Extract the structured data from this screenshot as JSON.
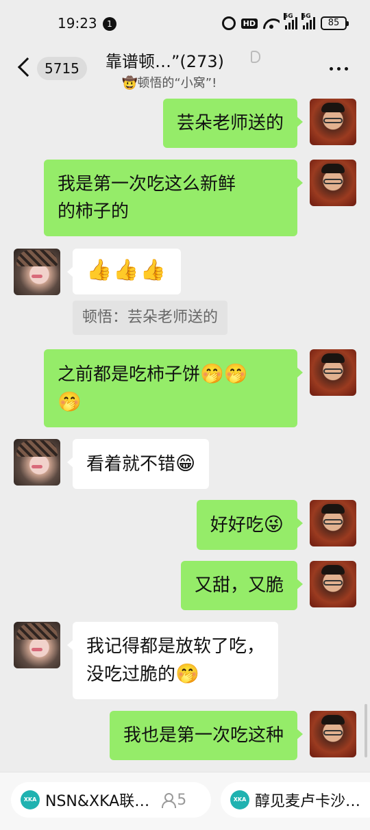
{
  "status_bar": {
    "time": "19:23",
    "notification_count": "1",
    "hd_label": "HD",
    "signal1_label": "5G",
    "signal2_label": "5G",
    "battery": "85"
  },
  "header": {
    "unread_count": "5715",
    "title": "靠谱顿…”(273)",
    "subtitle_emoji": "🤠",
    "subtitle": "顿悟的“小窝”!"
  },
  "messages": [
    {
      "sender": "me",
      "lines": [
        "芸朵老师送的"
      ]
    },
    {
      "sender": "me",
      "lines": [
        "我是第一次吃这么新鲜",
        "的柿子的"
      ]
    },
    {
      "sender": "her",
      "emoji": "👍👍👍",
      "quote": "顿悟：芸朵老师送的"
    },
    {
      "sender": "me",
      "lines": [
        "之前都是吃柿子饼",
        ""
      ],
      "emoji_line1": "🤭🤭",
      "emoji_line2": "🤭"
    },
    {
      "sender": "her",
      "lines": [
        "看着就不错"
      ],
      "emoji": "😁"
    },
    {
      "sender": "me",
      "lines": [
        "好好吃"
      ],
      "emoji": "😜"
    },
    {
      "sender": "me",
      "lines": [
        "又甜，又脆"
      ]
    },
    {
      "sender": "her",
      "lines": [
        "我记得都是放软了吃，",
        "没吃过脆的"
      ],
      "emoji": "🤭"
    },
    {
      "sender": "me",
      "lines": [
        "我也是第一次吃这种"
      ]
    }
  ],
  "bottom_bar": {
    "chip1_logo": "XKA",
    "chip1_label": "NSN&XKA联…",
    "chip1_count": "5",
    "chip2_logo": "XKA",
    "chip2_label": "醇见麦卢卡沙…"
  },
  "colors": {
    "my_bubble": "#95ec69",
    "their_bubble": "#ffffff",
    "background": "#ededed"
  }
}
